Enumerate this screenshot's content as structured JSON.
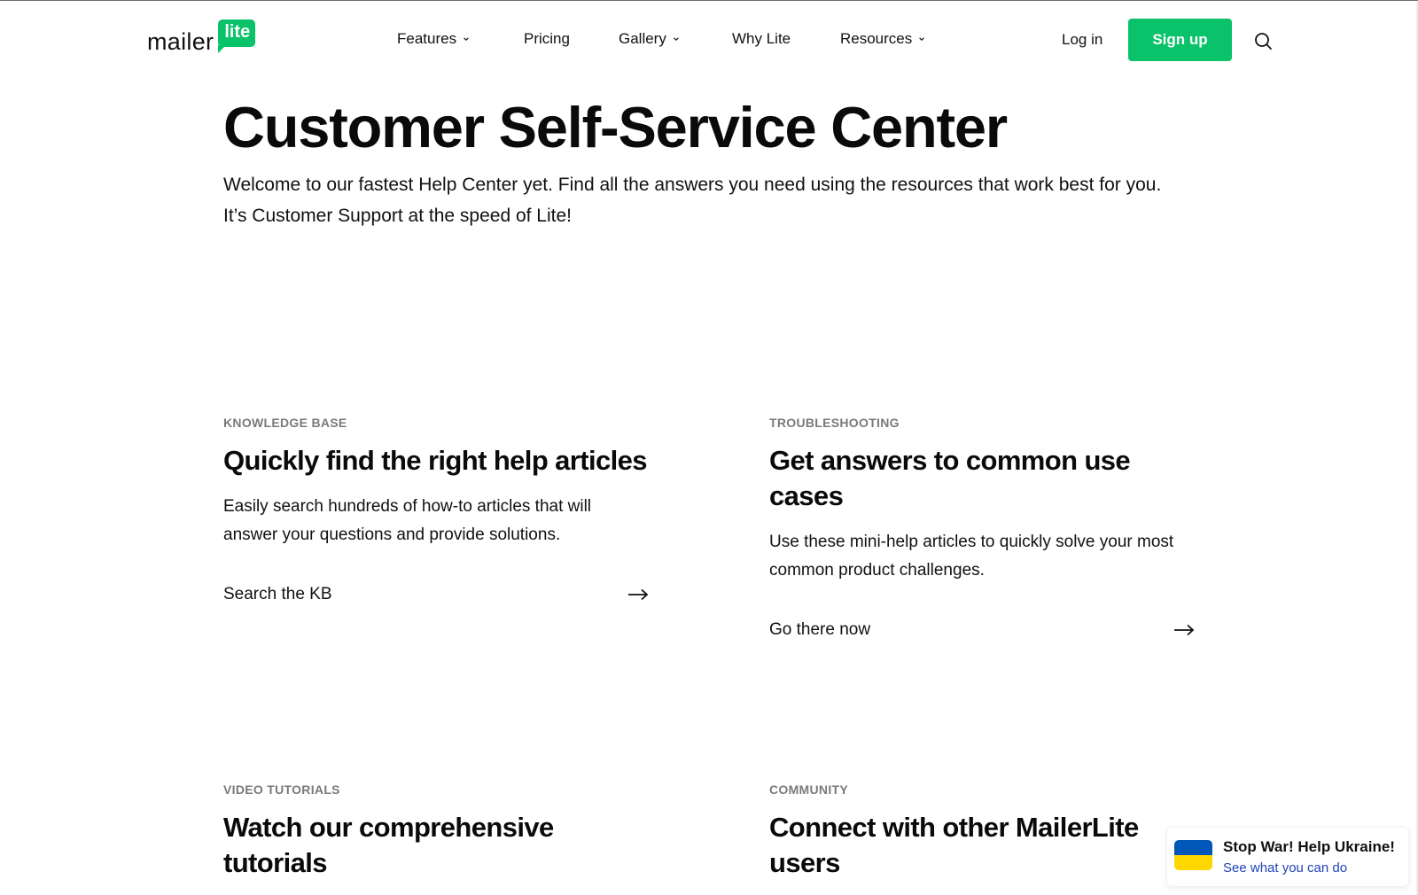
{
  "brand": {
    "word": "mailer",
    "badge": "lite",
    "accent": "#09c269"
  },
  "nav": {
    "items": [
      {
        "label": "Features",
        "has_dropdown": true
      },
      {
        "label": "Pricing",
        "has_dropdown": false
      },
      {
        "label": "Gallery",
        "has_dropdown": true
      },
      {
        "label": "Why Lite",
        "has_dropdown": false
      },
      {
        "label": "Resources",
        "has_dropdown": true
      }
    ],
    "login": "Log in",
    "signup": "Sign up",
    "search_icon": "search-icon"
  },
  "hero": {
    "title": "Customer Self-Service Center",
    "subtitle": "Welcome to our fastest Help Center yet. Find all the answers you need using the resources that work best for you. It’s Customer Support at the speed of Lite!"
  },
  "cards": [
    {
      "eyebrow": "KNOWLEDGE BASE",
      "title": "Quickly find the right help articles",
      "description": "Easily search hundreds of how-to articles that will answer your questions and provide solutions.",
      "link": "Search the KB"
    },
    {
      "eyebrow": "TROUBLESHOOTING",
      "title": "Get answers to common use cases",
      "description": "Use these mini-help articles to quickly solve your most common product challenges.",
      "link": "Go there now"
    },
    {
      "eyebrow": "VIDEO TUTORIALS",
      "title": "Watch our comprehensive tutorials"
    },
    {
      "eyebrow": "COMMUNITY",
      "title": "Connect with other MailerLite users"
    }
  ],
  "ukraine_banner": {
    "title": "Stop War! Help Ukraine!",
    "link": "See what you can do",
    "flag_colors": [
      "#0057b7",
      "#ffd700"
    ],
    "link_color": "#1f44b8"
  }
}
